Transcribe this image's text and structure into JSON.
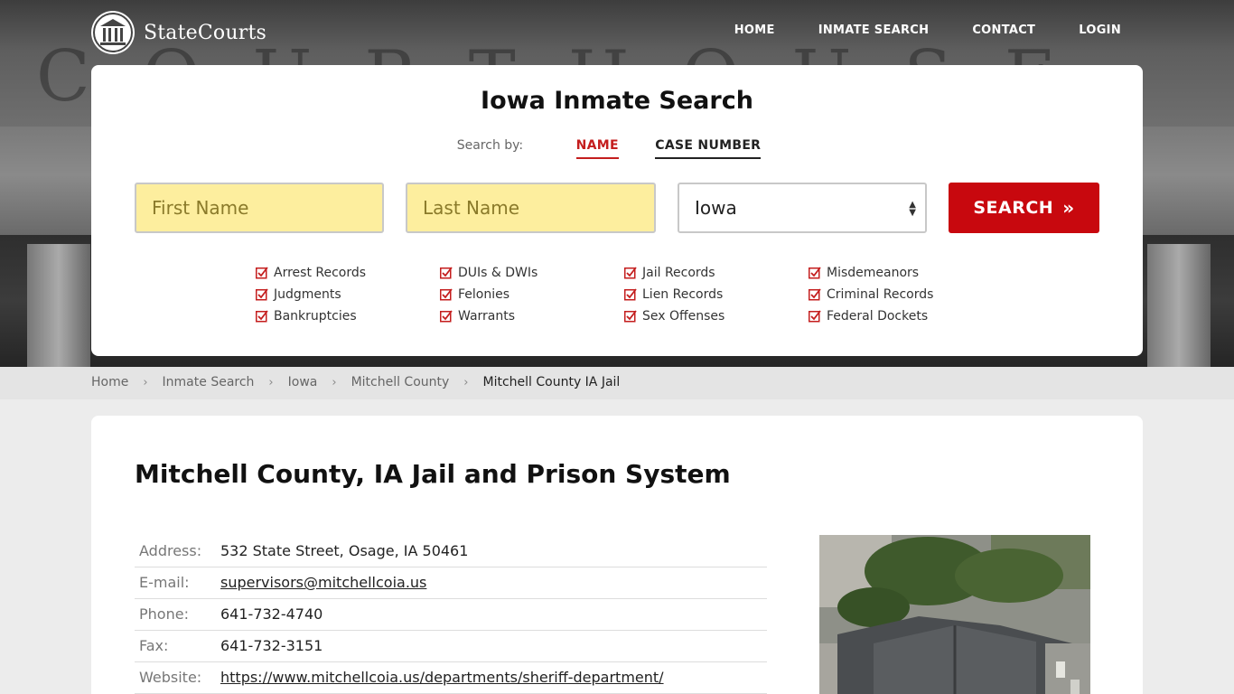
{
  "brand": {
    "name": "StateCourts"
  },
  "hero": {
    "carved_text": "COURTHOUSE"
  },
  "nav": {
    "items": [
      "HOME",
      "INMATE SEARCH",
      "CONTACT",
      "LOGIN"
    ]
  },
  "search": {
    "title": "Iowa Inmate Search",
    "search_by_label": "Search by:",
    "tabs": [
      {
        "label": "NAME",
        "active": true
      },
      {
        "label": "CASE NUMBER",
        "active": false
      }
    ],
    "first_name_placeholder": "First Name",
    "last_name_placeholder": "Last Name",
    "state_value": "Iowa",
    "button_label": "SEARCH",
    "categories": [
      "Arrest Records",
      "DUIs & DWIs",
      "Jail Records",
      "Misdemeanors",
      "Judgments",
      "Felonies",
      "Lien Records",
      "Criminal Records",
      "Bankruptcies",
      "Warrants",
      "Sex Offenses",
      "Federal Dockets"
    ]
  },
  "breadcrumb": {
    "items": [
      "Home",
      "Inmate Search",
      "Iowa",
      "Mitchell County"
    ],
    "current": "Mitchell County IA Jail"
  },
  "facility": {
    "title": "Mitchell County, IA Jail and Prison System",
    "rows": [
      {
        "key": "Address:",
        "value": "532 State Street, Osage, IA 50461",
        "link": false
      },
      {
        "key": "E-mail:",
        "value": "supervisors@mitchellcoia.us",
        "link": true
      },
      {
        "key": "Phone:",
        "value": "641-732-4740",
        "link": false
      },
      {
        "key": "Fax:",
        "value": "641-732-3151",
        "link": false
      },
      {
        "key": "Website:",
        "value": "https://www.mitchellcoia.us/departments/sheriff-department/",
        "link": true
      }
    ]
  },
  "colors": {
    "accent": "#c8080e",
    "input_fill": "#fdee9e",
    "active_tab": "#c41e1e"
  },
  "icons": {
    "logo": "courthouse-columns-icon",
    "check": "checkbox-checked-icon",
    "separator": "chevron-right-icon",
    "select": "updown-arrows-icon",
    "button": "double-chevron-right-icon"
  }
}
